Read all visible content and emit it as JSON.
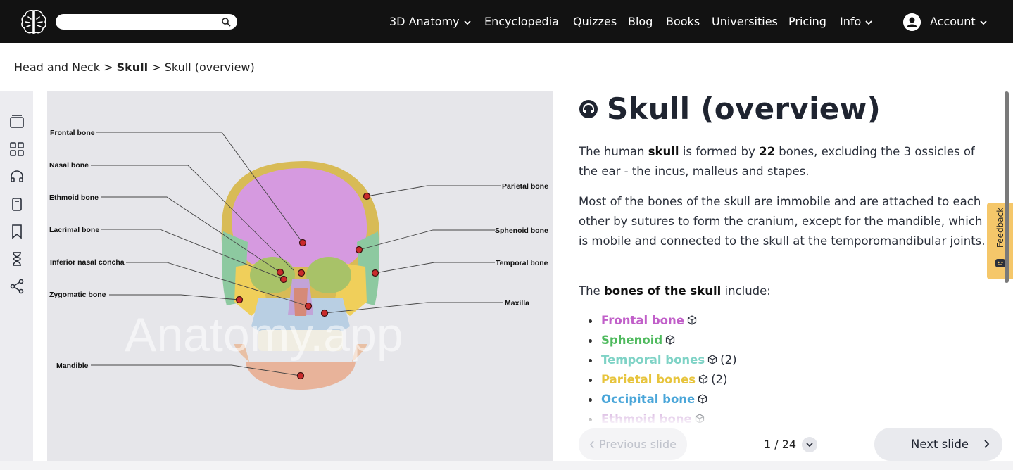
{
  "nav": {
    "links": [
      {
        "label": "3D Anatomy",
        "dropdown": true
      },
      {
        "label": "Encyclopedia",
        "dropdown": false
      },
      {
        "label": "Quizzes",
        "dropdown": false
      },
      {
        "label": "Blog",
        "dropdown": false
      },
      {
        "label": "Books",
        "dropdown": false
      },
      {
        "label": "Universities",
        "dropdown": false
      },
      {
        "label": "Pricing",
        "dropdown": false
      },
      {
        "label": "Info",
        "dropdown": true
      }
    ],
    "account_label": "Account",
    "search_placeholder": ""
  },
  "breadcrumb": {
    "item1": "Head and Neck",
    "item2": "Skull",
    "item3": "Skull (overview)",
    "separator": ">"
  },
  "figure": {
    "watermark": "Anatomy.app",
    "labels_left": [
      "Frontal bone",
      "Nasal bone",
      "Ethmoid bone",
      "Lacrimal bone",
      "Inferior nasal concha",
      "Zygomatic bone",
      "Mandible"
    ],
    "labels_right": [
      "Parietal bone",
      "Sphenoid bone",
      "Temporal bone",
      "Maxilla"
    ]
  },
  "article": {
    "title": "Skull (overview)",
    "p1": {
      "a": "The human ",
      "b": "skull",
      "c": " is formed by ",
      "d": "22",
      "e": " bones, excluding the 3 ossicles of the ear - the incus, malleus and stapes."
    },
    "p2": {
      "a": "Most of the bones of the skull are immobile and are attached to each other by sutures to form the cranium, except for the mandible, which is mobile and connected to the skull at the ",
      "link": "temporomandibular joints",
      "c": "."
    },
    "p3": {
      "a": "The ",
      "b": "bones of the skull",
      "c": " include:"
    },
    "bones": [
      {
        "name": "Frontal bone",
        "count": "",
        "color": "#c15fc9"
      },
      {
        "name": "Sphenoid",
        "count": "",
        "color": "#4fba5e"
      },
      {
        "name": "Temporal bones",
        "count": "(2)",
        "color": "#7fd3c6"
      },
      {
        "name": "Parietal bones",
        "count": "(2)",
        "color": "#e7c43c"
      },
      {
        "name": "Occipital bone",
        "count": "",
        "color": "#4aa6d9"
      },
      {
        "name": "Ethmoid bone",
        "count": "",
        "color": "#c28fd0"
      }
    ]
  },
  "pager": {
    "prev_label": "Previous slide",
    "next_label": "Next slide",
    "indicator": "1 / 24"
  },
  "feedback_label": "Feedback",
  "colors": {
    "navbar": "#121212",
    "panel": "#e6e6ea",
    "feedback": "#f5c76a"
  }
}
